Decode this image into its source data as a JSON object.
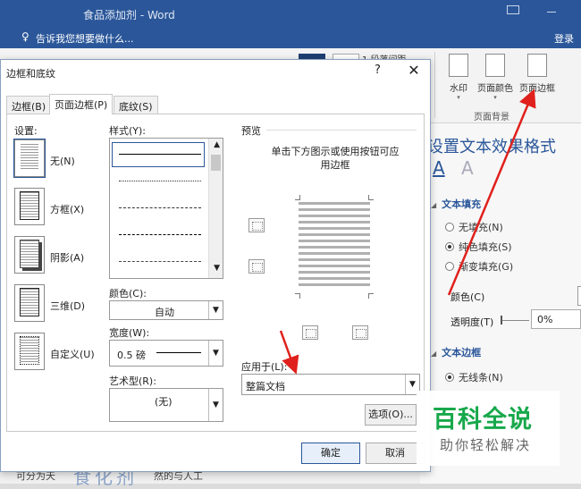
{
  "word": {
    "title": "食品添加剂 - Word",
    "tell_me": "告诉我您想要做什么...",
    "login": "登录",
    "ribbon_fragment": "1 段落间距",
    "ribbon": {
      "watermark": "水印",
      "page_color": "页面颜色",
      "page_border": "页面边框",
      "group": "页面背景"
    },
    "pane": {
      "title": "设置文本效果格式",
      "fill_section": "文本填充",
      "fill_options": [
        {
          "label": "无填充(N)"
        },
        {
          "label": "纯色填充(S)"
        },
        {
          "label": "渐变填充(G)"
        }
      ],
      "color_label": "颜色(C)",
      "transparency_label": "透明度(T)",
      "transparency_value": "0%",
      "outline_section": "文本边框",
      "outline_option": "无线条(N)"
    },
    "doc_strip": {
      "text1": "可分为天",
      "text2": "食化剂",
      "text3": "然的与人工"
    }
  },
  "dialog": {
    "title": "边框和底纹",
    "help": "?",
    "close": "✕",
    "tabs": [
      "边框(B)",
      "页面边框(P)",
      "底纹(S)"
    ],
    "setting_label": "设置:",
    "presets": [
      "无(N)",
      "方框(X)",
      "阴影(A)",
      "三维(D)",
      "自定义(U)"
    ],
    "style_label": "样式(Y):",
    "color_label": "颜色(C):",
    "color_value": "自动",
    "width_label": "宽度(W):",
    "width_value": "0.5 磅",
    "art_label": "艺术型(R):",
    "art_value": "(无)",
    "preview_label": "预览",
    "preview_hint": "单击下方图示或使用按钮可应用边框",
    "apply_label": "应用于(L):",
    "apply_value": "整篇文档",
    "options_button": "选项(O)...",
    "ok_button": "确定",
    "cancel_button": "取消"
  },
  "watermark": {
    "title": "百科全说",
    "subtitle": "助你轻松解决"
  },
  "colors": {
    "word_blue": "#2b579a",
    "annotation_red": "#e0201c",
    "watermark_green": "#17a84b"
  }
}
